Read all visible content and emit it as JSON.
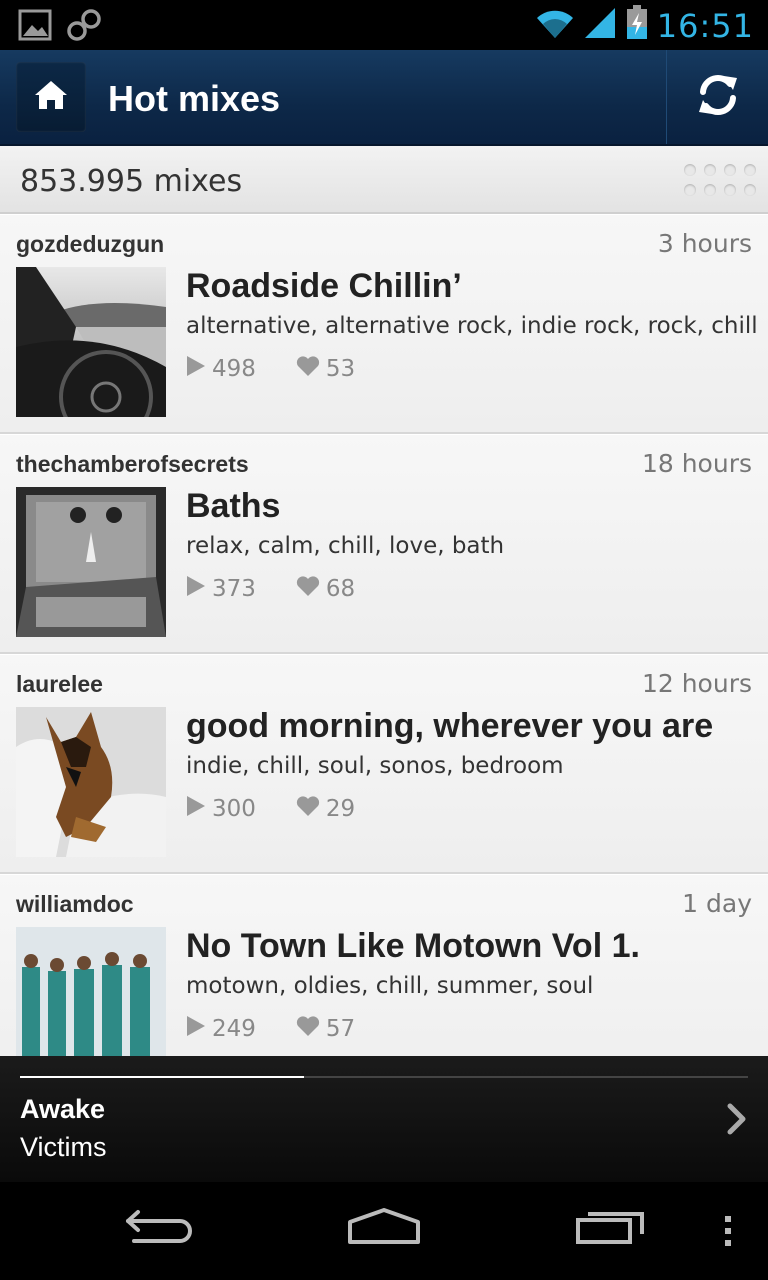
{
  "status_bar": {
    "time": "16:51",
    "icons": [
      "image-notification-icon",
      "infinity-notification-icon",
      "wifi-icon",
      "cell-signal-icon",
      "battery-charging-icon"
    ],
    "accent_color": "#33b5e5"
  },
  "action_bar": {
    "title": "Hot mixes",
    "home_icon": "home-icon",
    "refresh_icon": "refresh-icon"
  },
  "count_bar": {
    "count_text": "853.995 mixes"
  },
  "mixes": [
    {
      "user": "gozdeduzgun",
      "time": "3 hours",
      "title": "Roadside Chillin’",
      "tags": "alternative, alternative rock, indie rock, rock, chill",
      "plays": "498",
      "likes": "53"
    },
    {
      "user": "thechamberofsecrets",
      "time": "18 hours",
      "title": "Baths",
      "tags": "relax, calm, chill, love, bath",
      "plays": "373",
      "likes": "68"
    },
    {
      "user": "laurelee",
      "time": "12 hours",
      "title": "good morning, wherever you are",
      "tags": "indie, chill, soul, sonos, bedroom",
      "plays": "300",
      "likes": "29"
    },
    {
      "user": "williamdoc",
      "time": "1 day",
      "title": "No Town Like Motown Vol 1.",
      "tags": "motown, oldies, chill, summer, soul",
      "plays": "249",
      "likes": "57"
    }
  ],
  "now_playing": {
    "track": "Awake",
    "artist": "Victims",
    "progress_fraction": 0.39
  },
  "nav_bar": {
    "icons": [
      "back-icon",
      "home-nav-icon",
      "recent-apps-icon",
      "menu-icon"
    ]
  }
}
